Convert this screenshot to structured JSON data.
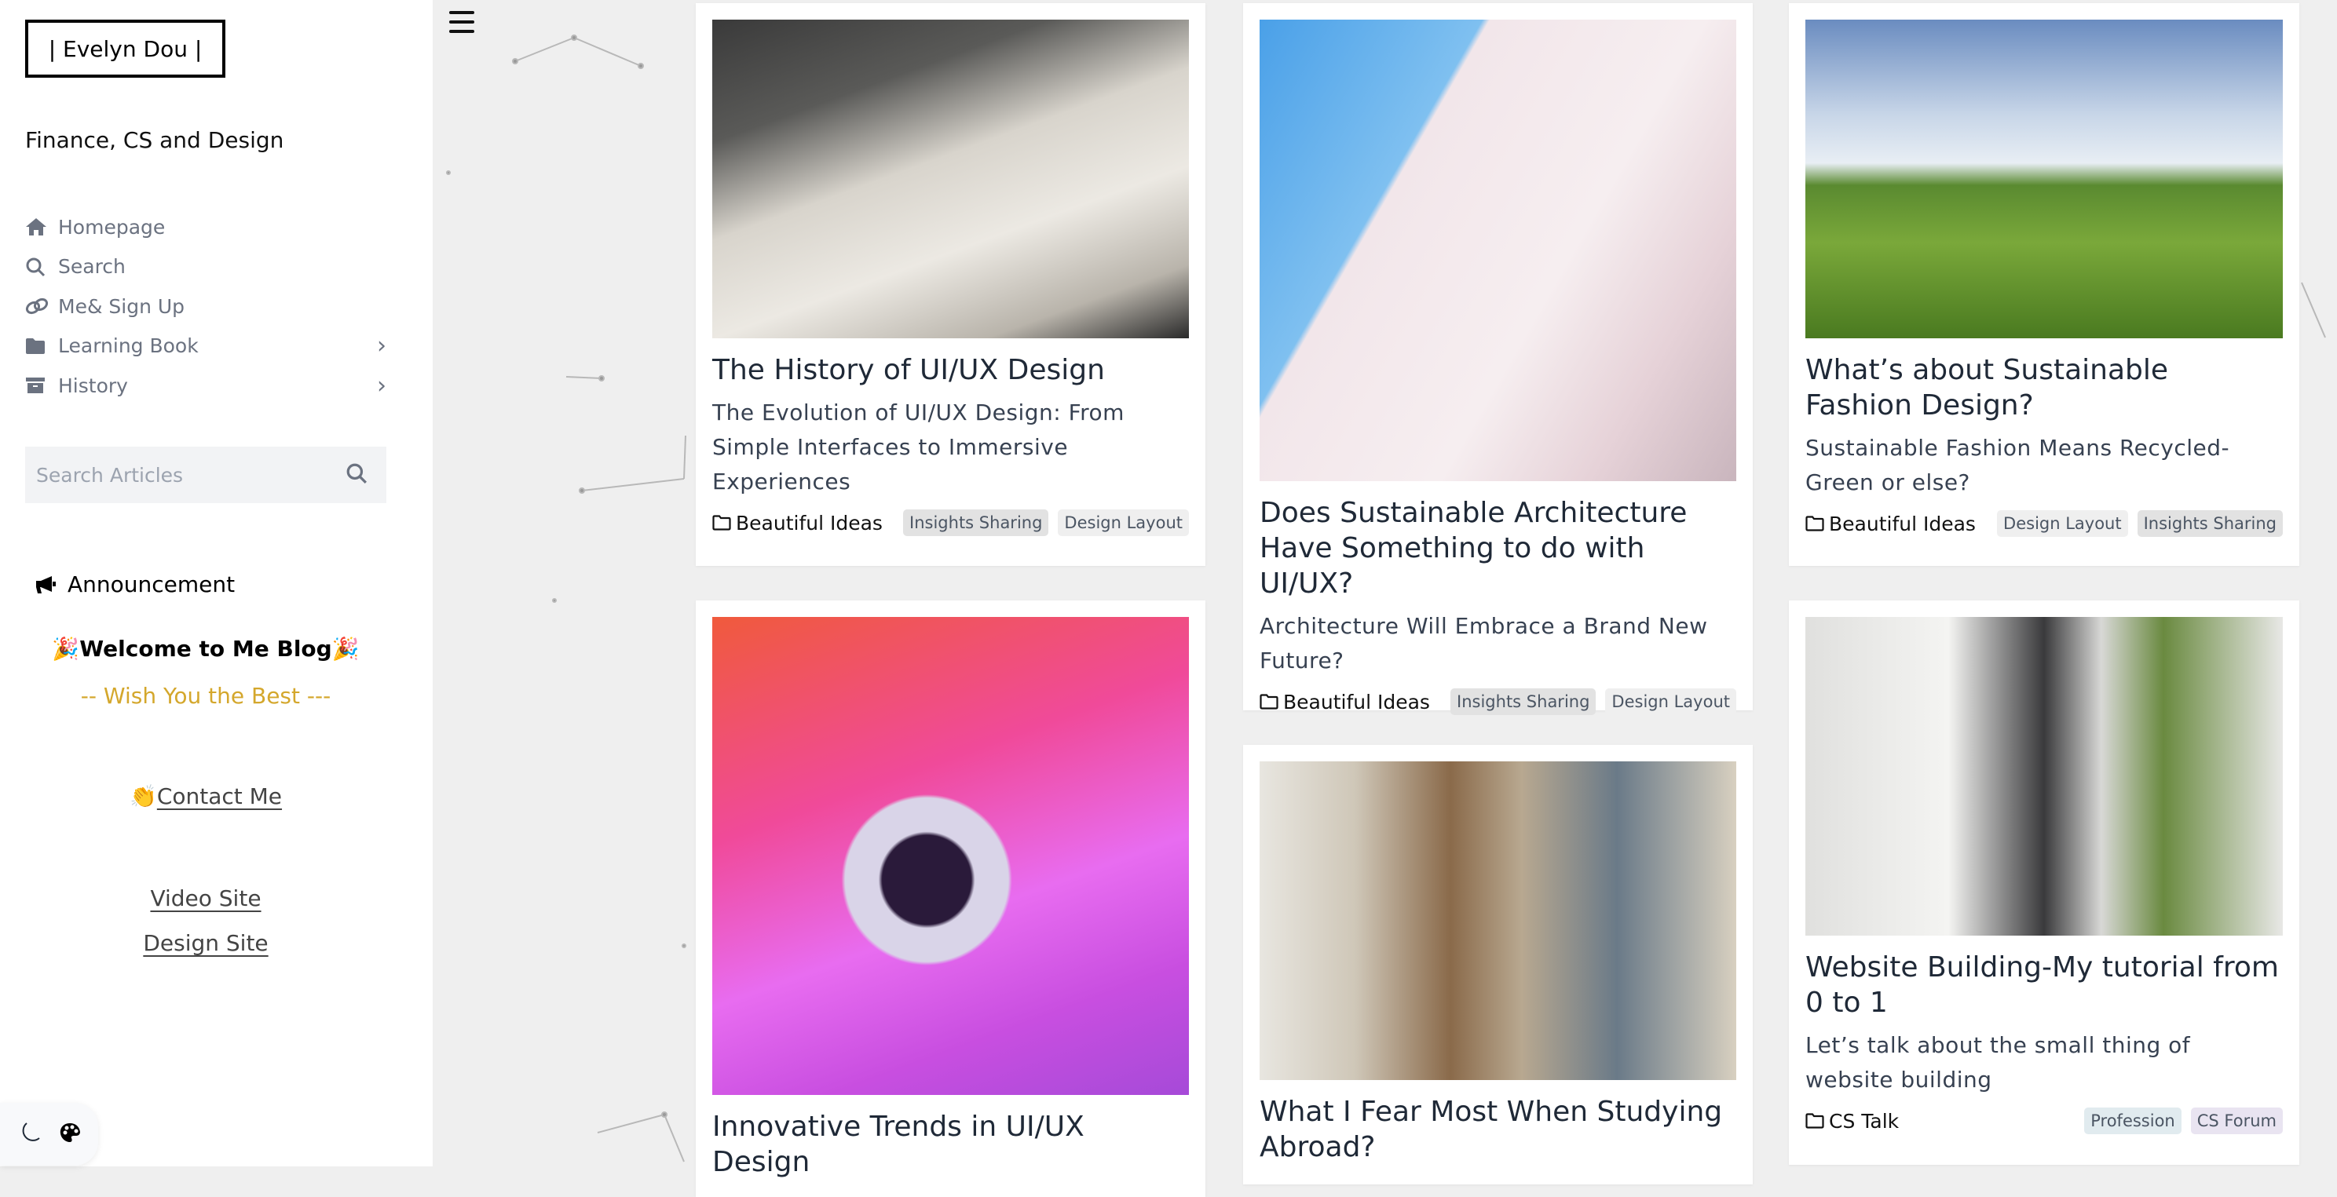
{
  "sidebar": {
    "logo": "| Evelyn Dou |",
    "tagline": "Finance, CS and Design",
    "nav": [
      {
        "label": "Homepage",
        "icon": "home-icon"
      },
      {
        "label": "Search",
        "icon": "search-icon"
      },
      {
        "label": "Me& Sign Up",
        "icon": "link-icon"
      },
      {
        "label": "Learning Book",
        "icon": "folder-icon",
        "expandable": true
      },
      {
        "label": "History",
        "icon": "archive-icon",
        "expandable": true
      }
    ],
    "search_placeholder": "Search Articles",
    "announcement": {
      "title": "Announcement",
      "welcome": "🎉Welcome to Me Blog🎉",
      "wish": "-- Wish You the Best  ---",
      "contact_emoji": "👏",
      "contact": "Contact Me",
      "video_site": "Video Site",
      "design_site": "Design Site"
    }
  },
  "colors": {
    "accent": "#d4a72c",
    "nav_text": "#6b7280"
  },
  "cards": [
    {
      "title": "The History of UI/UX Design",
      "desc": "The Evolution of UI/UX Design: From Simple Interfaces to Immersive Experiences",
      "category": "Beautiful Ideas",
      "tags": [
        "Insights Sharing",
        "Design Layout"
      ]
    },
    {
      "title": "Does Sustainable Architecture Have Something to do with UI/UX?",
      "desc": "Architecture Will Embrace a Brand New Future?",
      "category": "Beautiful Ideas",
      "tags": [
        "Insights Sharing",
        "Design Layout"
      ]
    },
    {
      "title": "What’s about Sustainable Fashion Design?",
      "desc": "Sustainable Fashion Means Recycled-Green or else?",
      "category": "Beautiful Ideas",
      "tags": [
        "Design Layout",
        "Insights Sharing"
      ]
    },
    {
      "title": "Innovative Trends in UI/UX Design"
    },
    {
      "title": "What I Fear Most When Studying Abroad?"
    },
    {
      "title": "Website Building-My tutorial from 0 to 1",
      "desc": "Let’s talk about the small thing of website building",
      "category": "CS Talk",
      "tags": [
        "Profession",
        "CS Forum"
      ]
    }
  ]
}
